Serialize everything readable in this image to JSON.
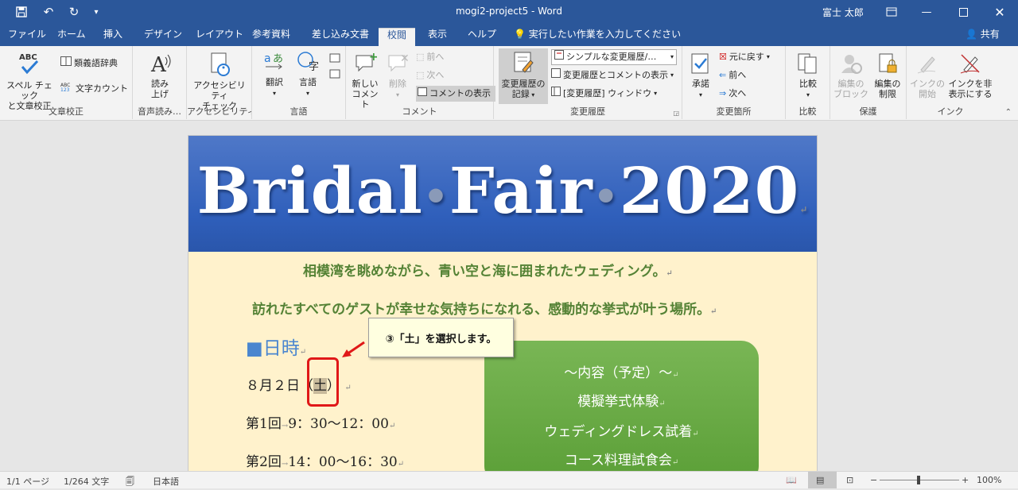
{
  "titlebar": {
    "doc_title": "mogi2-project5 - Word",
    "user": "富士 太郎"
  },
  "tabs": [
    "ファイル",
    "ホーム",
    "挿入",
    "デザイン",
    "レイアウト",
    "参考資料",
    "差し込み文書",
    "校閲",
    "表示",
    "ヘルプ"
  ],
  "tell_me": "実行したい作業を入力してください",
  "share": "共有",
  "ribbon": {
    "proofing": {
      "label": "文章校正",
      "spell": "スペル チェック\nと文章校正",
      "thesaurus": "類義語辞典",
      "wordcount": "文字カウント"
    },
    "speech": {
      "label": "音声読み…",
      "read": "読み\n上げ"
    },
    "access": {
      "label": "アクセシビリティ",
      "check": "アクセシビリティ\nチェック"
    },
    "language": {
      "label": "言語",
      "translate": "翻訳",
      "lang": "言語"
    },
    "comments": {
      "label": "コメント",
      "new": "新しい\nコメント",
      "delete": "削除",
      "prev": "前へ",
      "next": "次へ",
      "show": "コメントの表示"
    },
    "tracking": {
      "label": "変更履歴",
      "track": "変更履歴の\n記録",
      "display": "シンプルな変更履歴/…",
      "show_markup": "変更履歴とコメントの表示",
      "pane": "[変更履歴] ウィンドウ"
    },
    "changes": {
      "label": "変更箇所",
      "accept": "承諾",
      "reject": "元に戻す",
      "prev": "前へ",
      "next": "次へ"
    },
    "compare": {
      "label": "比較",
      "compare": "比較"
    },
    "protect": {
      "label": "保護",
      "block": "編集の\nブロック",
      "restrict": "編集の\n制限"
    },
    "ink": {
      "label": "インク",
      "start": "インクの\n開始",
      "hide": "インクを非\n表示にする"
    }
  },
  "document": {
    "banner_parts": [
      "Bridal",
      "•",
      "Fair",
      "•",
      "2020"
    ],
    "line1": "相模湾を眺めながら、青い空と海に囲まれたウェディング。",
    "line2": "訪れたすべてのゲストが幸せな気持ちになれる、感動的な挙式が叶う場所。",
    "heading": "■日時",
    "date_prefix": "８月２日（",
    "date_selected": "土",
    "date_suffix": "）",
    "session1_label": "第1回",
    "session1_time": "9：30〜12：00",
    "session2_label": "第2回",
    "session2_time": "14：00〜16：30",
    "box_title": "〜内容（予定）〜",
    "box_items": [
      "模擬挙式体験",
      "ウェディングドレス試着",
      "コース料理試食会"
    ],
    "para_mark": "↵",
    "tab_mark": "→"
  },
  "callout": {
    "text": "③「土」を選択します。"
  },
  "status": {
    "page": "1/1 ページ",
    "words": "1/264 文字",
    "lang": "日本語",
    "zoom": "100%"
  },
  "colors": {
    "title_bar": "#2b579a",
    "accent": "#2b579a",
    "banner": "#2f5fbb",
    "highlight_green": "#548235",
    "callout_red": "#e01818"
  }
}
